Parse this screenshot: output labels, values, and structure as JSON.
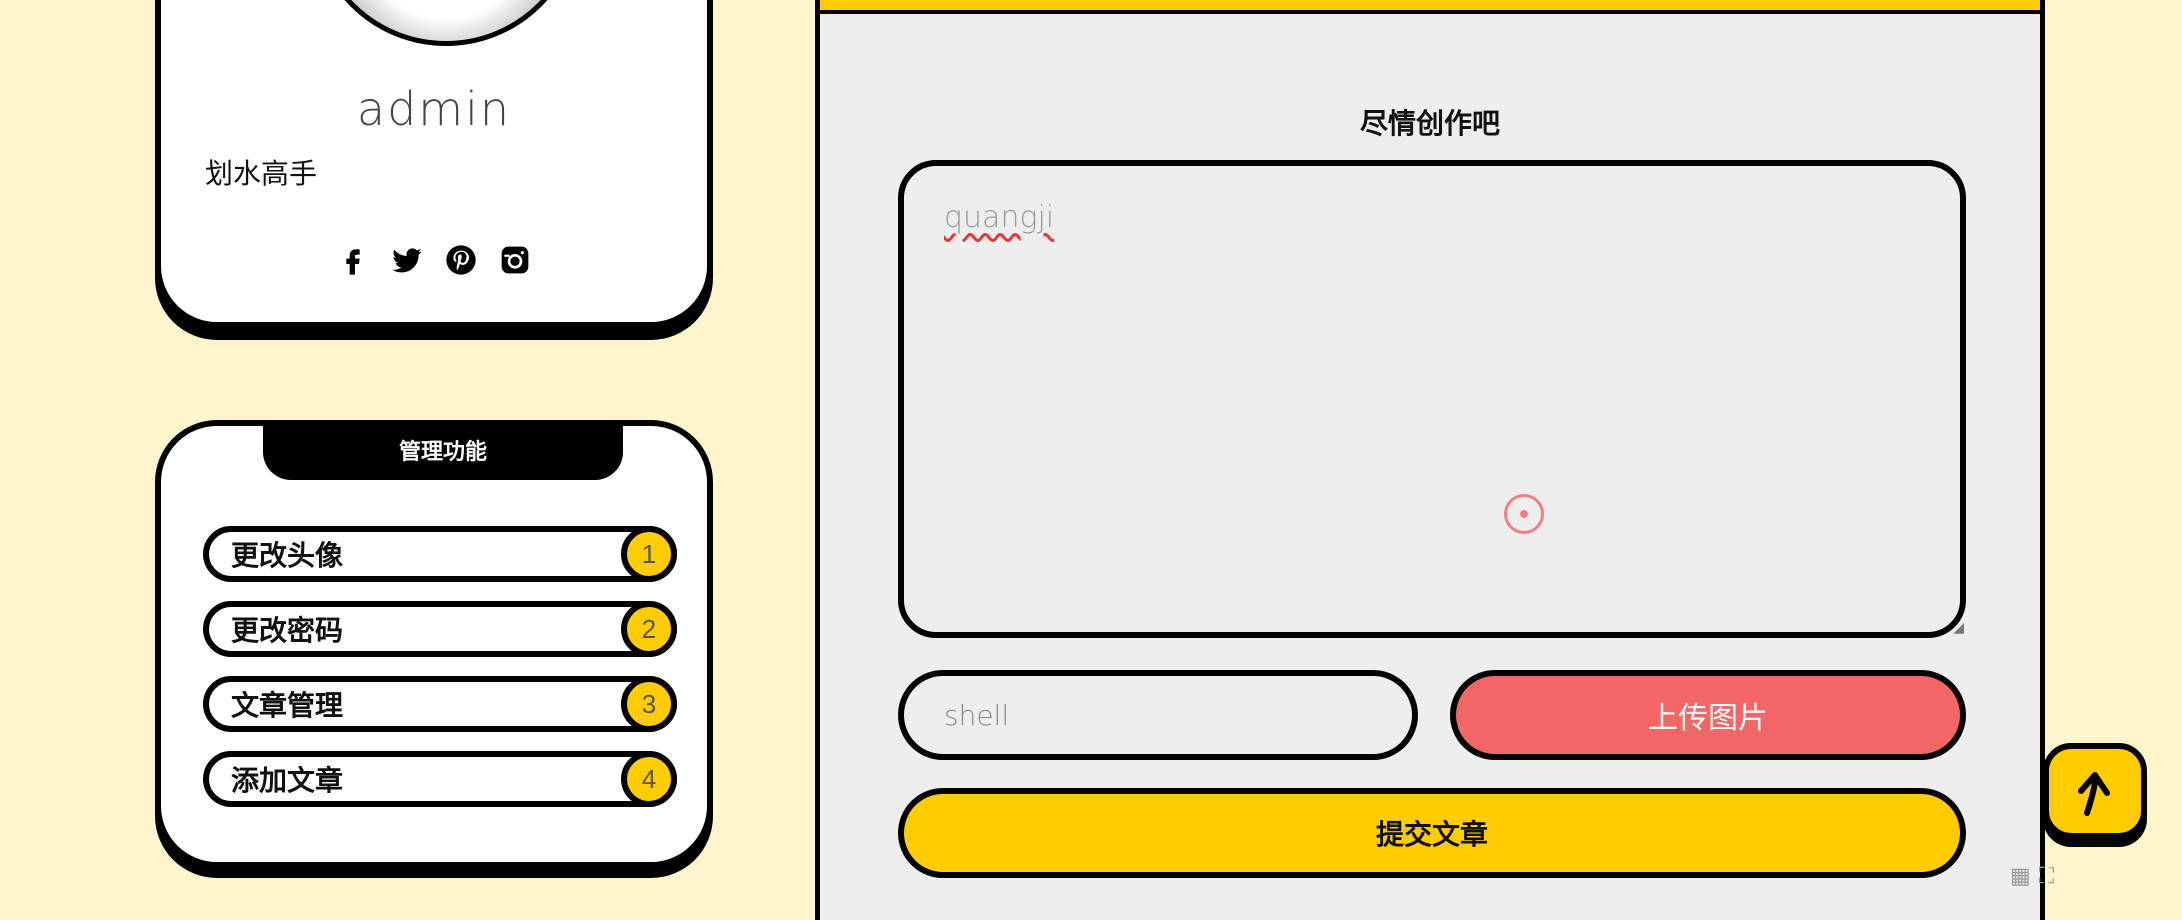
{
  "profile": {
    "username": "admin",
    "bio": "划水高手",
    "socials": [
      "facebook-icon",
      "twitter-icon",
      "pinterest-icon",
      "instagram-icon"
    ]
  },
  "admin": {
    "title": "管理功能",
    "items": [
      {
        "label": "更改头像",
        "num": "1"
      },
      {
        "label": "更改密码",
        "num": "2"
      },
      {
        "label": "文章管理",
        "num": "3"
      },
      {
        "label": "添加文章",
        "num": "4"
      }
    ]
  },
  "editor": {
    "title": "尽情创作吧",
    "content": "quangji",
    "shell_value": "shell",
    "upload_label": "上传图片",
    "submit_label": "提交文章"
  },
  "widget": {
    "grid_glyph": "▦"
  },
  "colors": {
    "background": "#FFF5CC",
    "accent": "#FFCC00",
    "upload": "#F26666",
    "panel": "#EEEEEE"
  }
}
